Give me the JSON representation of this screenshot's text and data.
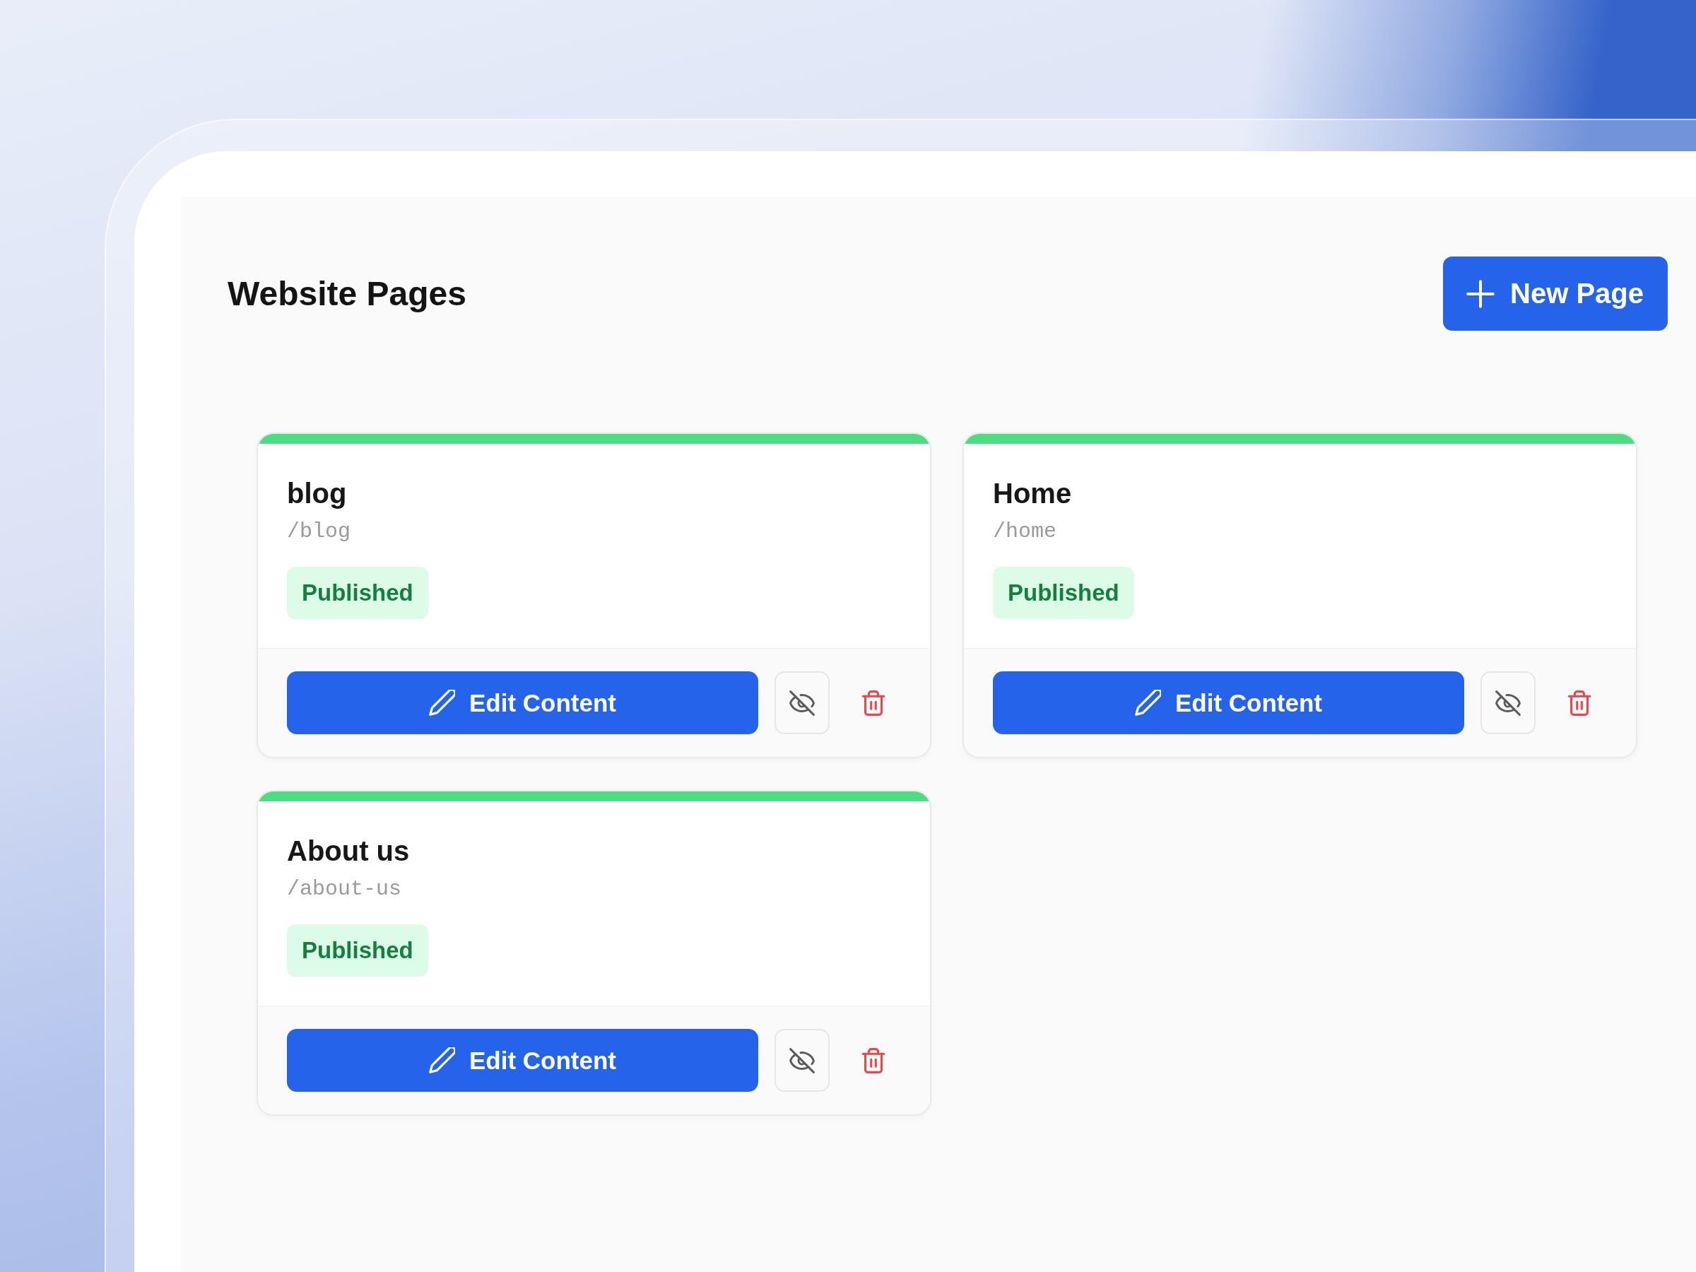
{
  "header": {
    "title": "Website Pages",
    "new_page_button": "New Page"
  },
  "pages": [
    {
      "title": "blog",
      "path": "/blog",
      "status": "Published",
      "edit_button": "Edit Content"
    },
    {
      "title": "Home",
      "path": "/home",
      "status": "Published",
      "edit_button": "Edit Content"
    },
    {
      "title": "About us",
      "path": "/about-us",
      "status": "Published",
      "edit_button": "Edit Content"
    }
  ]
}
